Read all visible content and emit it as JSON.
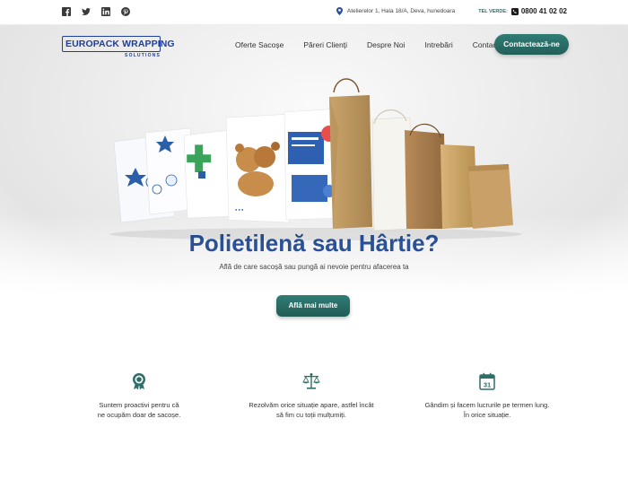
{
  "topbar": {
    "social": [
      "facebook-icon",
      "twitter-icon",
      "linkedin-icon",
      "pinterest-icon"
    ],
    "address": "Atelierelor 1, Hala 18/A, Deva, hunedoara",
    "tel_label": "TEL VERDE:",
    "phone": "0800 41 02 02"
  },
  "header": {
    "logo_main": "EUROPACK WRAPPING",
    "logo_sub": "SOLUTIONS",
    "nav": [
      "Oferte Sacoșe",
      "Păreri Clienți",
      "Despre Noi",
      "Intrebări",
      "Contact"
    ],
    "cta": "Contactează-ne"
  },
  "hero": {
    "title": "Polietilenă sau Hârtie?",
    "subtitle": "Află de care sacoșă sau pungă ai nevoie pentru afacerea ta",
    "button": "Află mai multe"
  },
  "features": [
    {
      "icon": "award-icon",
      "line1": "Suntem proactivi pentru că",
      "line2": "ne ocupăm doar de sacoșe."
    },
    {
      "icon": "scales-icon",
      "line1": "Rezolvăm orice situație apare, astfel încât",
      "line2": "să fim cu toții mulțumiți."
    },
    {
      "icon": "calendar-icon",
      "line1": "Gândim și facem lucrurile pe termen lung.",
      "line2": "În orice situație.",
      "calendar_day": "31"
    }
  ],
  "colors": {
    "brand_blue": "#2a5196",
    "accent_teal": "#2f7d75"
  }
}
